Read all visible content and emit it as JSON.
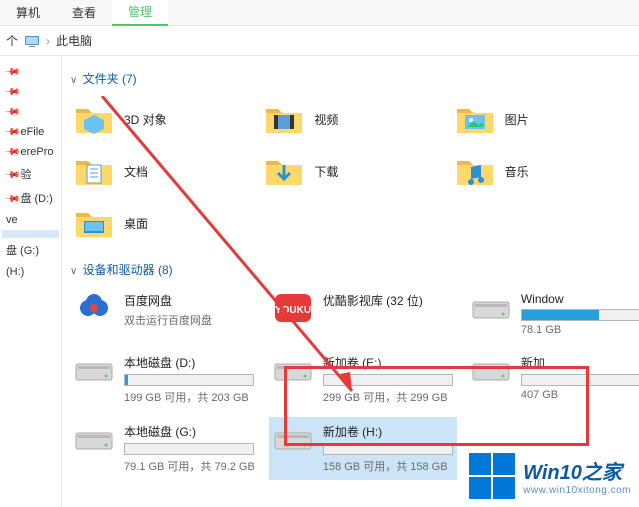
{
  "toolbar": {
    "tab_computer": "算机",
    "tab_view": "查看",
    "tab_manage": "管理"
  },
  "breadcrumb": {
    "arrow": "个",
    "location": "此电脑"
  },
  "sidebar": {
    "items": [
      "",
      "",
      "",
      "eFile",
      "erePro",
      "验",
      "盘 (D:)",
      "ve",
      "",
      "盘 (G:)",
      "(H:)"
    ]
  },
  "sections": {
    "folders_title": "文件夹 (7)",
    "drives_title": "设备和驱动器 (8)"
  },
  "folders": [
    {
      "label": "3D 对象"
    },
    {
      "label": "视频"
    },
    {
      "label": "图片"
    },
    {
      "label": "文档"
    },
    {
      "label": "下载"
    },
    {
      "label": "音乐"
    },
    {
      "label": "桌面"
    }
  ],
  "drives": [
    {
      "name": "百度网盘",
      "sub": "双击运行百度网盘",
      "type": "cloud"
    },
    {
      "name": "优酷影视库 (32 位)",
      "sub": "",
      "type": "youku"
    },
    {
      "name": "Window",
      "sub": "78.1 GB",
      "type": "disk",
      "fill": 60
    },
    {
      "name": "本地磁盘 (D:)",
      "sub": "199 GB 可用，共 203 GB",
      "type": "disk",
      "fill": 2
    },
    {
      "name": "新加卷 (E:)",
      "sub": "299 GB 可用，共 299 GB",
      "type": "disk",
      "fill": 0
    },
    {
      "name": "新加",
      "sub": "407 GB",
      "type": "disk",
      "fill": 0
    },
    {
      "name": "本地磁盘 (G:)",
      "sub": "79.1 GB 可用，共 79.2 GB",
      "type": "disk",
      "fill": 0
    },
    {
      "name": "新加卷 (H:)",
      "sub": "158 GB 可用，共 158 GB",
      "type": "disk",
      "fill": 0,
      "highlight": true
    }
  ],
  "watermark": {
    "title": "Win10之家",
    "url": "www.win10xitong.com"
  }
}
